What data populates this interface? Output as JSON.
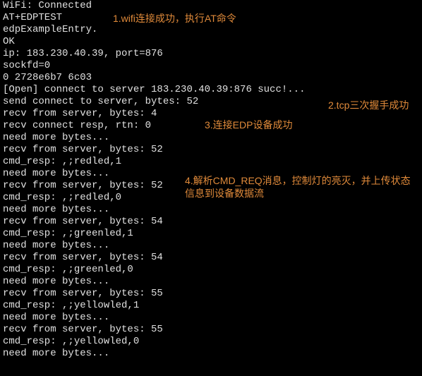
{
  "terminal": {
    "lines": [
      "WiFi: Connected",
      "AT+EDPTEST",
      "edpExampleEntry.",
      "OK",
      "",
      "ip: 183.230.40.39, port=876",
      "sockfd=0",
      "0 2728e6b7 6c03",
      "[Open] connect to server 183.230.40.39:876 succ!...",
      "send connect to server, bytes: 52",
      "recv from server, bytes: 4",
      "recv connect resp, rtn: 0",
      "need more bytes...",
      "recv from server, bytes: 52",
      "cmd_resp: ,;redled,1",
      "need more bytes...",
      "recv from server, bytes: 52",
      "cmd_resp: ,;redled,0",
      "need more bytes...",
      "recv from server, bytes: 54",
      "cmd_resp: ,;greenled,1",
      "need more bytes...",
      "recv from server, bytes: 54",
      "cmd_resp: ,;greenled,0",
      "need more bytes...",
      "recv from server, bytes: 55",
      "cmd_resp: ,;yellowled,1",
      "need more bytes...",
      "recv from server, bytes: 55",
      "cmd_resp: ,;yellowled,0",
      "need more bytes..."
    ]
  },
  "annotations": {
    "a1": "1.wifi连接成功，执行AT命令",
    "a2": "2.tcp三次握手成功",
    "a3": "3.连接EDP设备成功",
    "a4": "4.解析CMD_REQ消息，控制灯的亮灭，并上传状态信息到设备数据流"
  }
}
